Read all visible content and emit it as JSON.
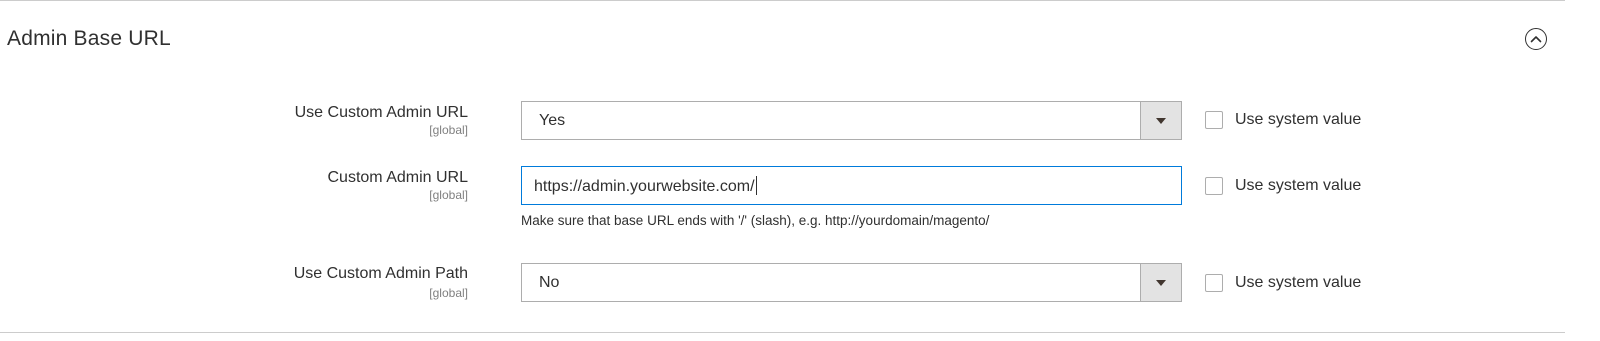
{
  "section": {
    "title": "Admin Base URL",
    "toggle_state": "expanded"
  },
  "fields": [
    {
      "label": "Use Custom Admin URL",
      "scope": "[global]",
      "type": "select",
      "value": "Yes",
      "use_system_value_label": "Use system value",
      "use_system_value_checked": false
    },
    {
      "label": "Custom Admin URL",
      "scope": "[global]",
      "type": "text",
      "value": "https://admin.yourwebsite.com/",
      "note": "Make sure that base URL ends with '/' (slash), e.g. http://yourdomain/magento/",
      "use_system_value_label": "Use system value",
      "use_system_value_checked": false
    },
    {
      "label": "Use Custom Admin Path",
      "scope": "[global]",
      "type": "select",
      "value": "No",
      "use_system_value_label": "Use system value",
      "use_system_value_checked": false
    }
  ],
  "icons": {
    "toggle": "chevron-up-circle-icon",
    "select_arrow": "triangle-down-icon"
  },
  "colors": {
    "text": "#303030",
    "scope_text": "#808080",
    "focus_border": "#007bdb",
    "input_border": "#adadad",
    "arrow_bg": "#e3e3e3"
  }
}
